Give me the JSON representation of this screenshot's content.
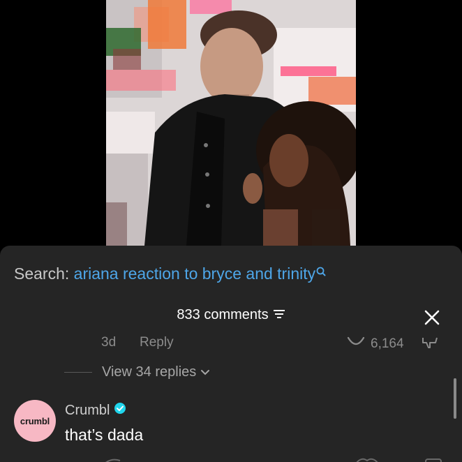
{
  "search": {
    "prefix": "Search:",
    "query": "ariana reaction to bryce and trinity",
    "icon": "search-icon"
  },
  "comments_header": {
    "count_label": "833 comments",
    "filter_icon": "filter-icon",
    "close_icon": "close-icon"
  },
  "previous_comment_meta": {
    "time": "3d",
    "reply_label": "Reply",
    "like_count": "6,164"
  },
  "view_replies": {
    "label": "View 34 replies"
  },
  "comment": {
    "avatar_text": "crumbl",
    "username": "Crumbl",
    "verified_icon": "verified-badge-icon",
    "text": "that’s dada"
  },
  "colors": {
    "sheet_bg": "#252525",
    "link_blue": "#4ea6e8",
    "avatar_pink": "#f7b8c4",
    "verified_blue": "#20d5ec"
  }
}
